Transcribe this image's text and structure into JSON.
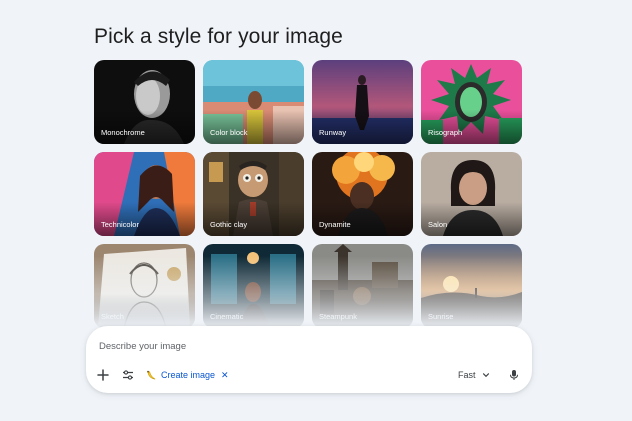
{
  "page_title": "Pick a style for your image",
  "styles": [
    {
      "label": "Monochrome"
    },
    {
      "label": "Color block"
    },
    {
      "label": "Runway"
    },
    {
      "label": "Risograph"
    },
    {
      "label": "Technicolor"
    },
    {
      "label": "Gothic clay"
    },
    {
      "label": "Dynamite"
    },
    {
      "label": "Salon"
    },
    {
      "label": "Sketch"
    },
    {
      "label": "Cinematic"
    },
    {
      "label": "Steampunk"
    },
    {
      "label": "Sunrise"
    }
  ],
  "composer": {
    "placeholder": "Describe your image",
    "value": "",
    "add_icon": "plus-icon",
    "tools_icon": "tune-icon",
    "tool_chip": {
      "label": "Create image",
      "icon": "banana-icon",
      "close_icon": "close-icon"
    },
    "model": {
      "label": "Fast",
      "icon": "chevron-down-icon"
    },
    "mic_icon": "mic-icon"
  },
  "colors": {
    "background": "#f0f4f9",
    "accent": "#0b57d0",
    "text": "#1f1f1f"
  }
}
